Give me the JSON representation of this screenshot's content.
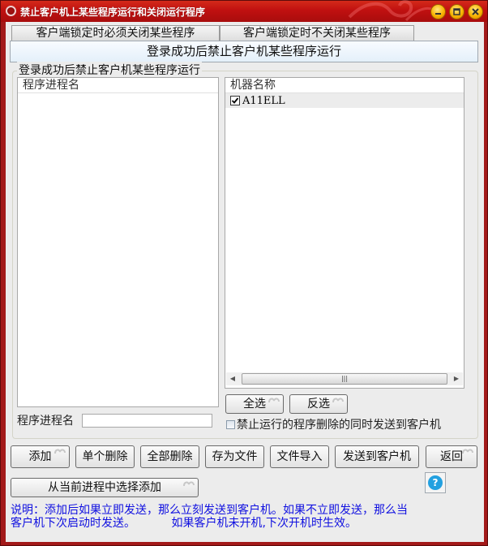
{
  "window": {
    "title": "禁止客户机上某些程序运行和关闭运行程序",
    "controls": [
      "minimize-icon",
      "maximize-icon",
      "close-icon"
    ]
  },
  "tabs": {
    "tab1": "客户端锁定时必须关闭某些程序",
    "tab2": "客户端锁定时不关闭某些程序",
    "active": "登录成功后禁止客户机某些程序运行"
  },
  "group": {
    "title": "登录成功后禁止客户机某些程序运行",
    "process_list": {
      "header": "程序进程名",
      "items": []
    },
    "machine_list": {
      "header": "机器名称",
      "items": [
        {
          "name": "A11ELL",
          "checked": true
        }
      ]
    },
    "select_all": "全选",
    "invert_select": "反选",
    "process_name_label": "程序进程名",
    "process_name_value": "",
    "sync_delete_label": "禁止运行的程序删除的同时发送到客户机",
    "sync_delete_checked": false
  },
  "buttons": {
    "add": "添加",
    "delete_one": "单个删除",
    "delete_all": "全部删除",
    "save_file": "存为文件",
    "import_file": "文件导入",
    "send_client": "发送到客户机",
    "back": "返回",
    "add_from_process": "从当前进程中选择添加",
    "help": "?"
  },
  "note": {
    "line1": "说明：添加后如果立即发送，那么立刻发送到客户机。如果不立即发送，那么当",
    "line2": "客户机下次启动时发送。          如果客户机未开机,下次开机时生效。"
  }
}
